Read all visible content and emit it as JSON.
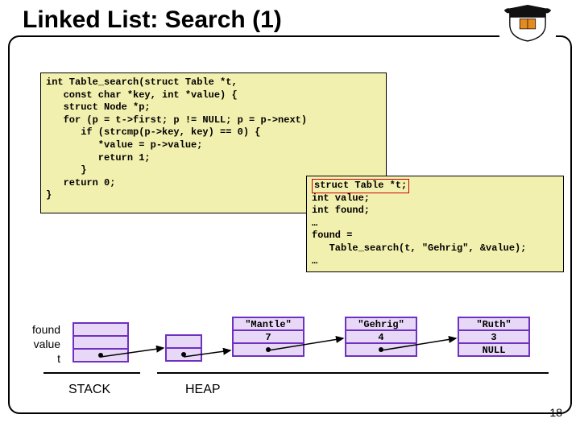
{
  "title": "Linked List: Search (1)",
  "code1": "int Table_search(struct Table *t,\n   const char *key, int *value) {\n   struct Node *p;\n   for (p = t->first; p != NULL; p = p->next)\n      if (strcmp(p->key, key) == 0) {\n         *value = p->value;\n         return 1;\n      }\n   return 0;\n}",
  "code2_pre": "",
  "code2_highlight": "struct Table *t;",
  "code2_post": "int value;\nint found;\n…\nfound =\n   Table_search(t, \"Gehrig\", &value);\n…",
  "stack": {
    "labels": [
      "found",
      "value",
      "t"
    ]
  },
  "nodes": [
    {
      "key": "\"Mantle\"",
      "val": "7",
      "next_dot": true
    },
    {
      "key": "\"Gehrig\"",
      "val": "4",
      "next_dot": true
    },
    {
      "key": "\"Ruth\"",
      "val": "3",
      "next_label": "NULL"
    }
  ],
  "labels": {
    "stack": "STACK",
    "heap": "HEAP"
  },
  "pagenum": "18"
}
